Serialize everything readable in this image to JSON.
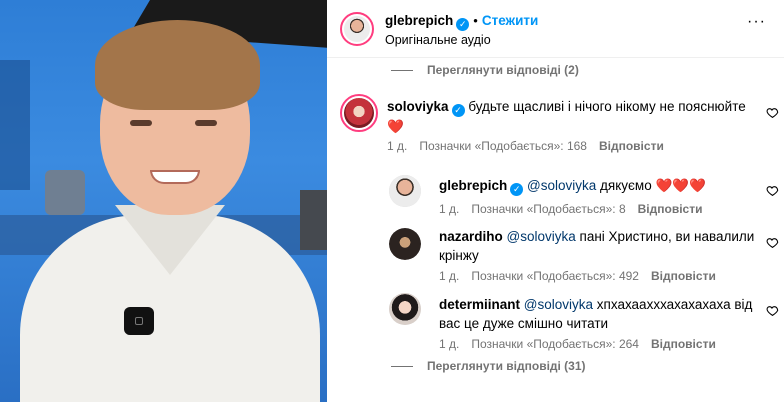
{
  "header": {
    "username": "glebrepich",
    "follow_label": "Стежити",
    "dot": "•",
    "audio": "Оригінальне аудіо",
    "more": "···"
  },
  "view_replies_top": "Переглянути відповіді (2)",
  "comment": {
    "username": "soloviyka",
    "text": "будьте щасливі і нічого нікому не пояснюйте",
    "emoji": "❤️",
    "time": "1 д.",
    "likes": "Позначки «Подобається»: 168",
    "reply_label": "Відповісти"
  },
  "replies": [
    {
      "username": "glebrepich",
      "verified": true,
      "mention": "@soloviyka",
      "text": "дякуємо",
      "emoji": "❤️❤️❤️",
      "time": "1 д.",
      "likes": "Позначки «Подобається»: 8",
      "reply_label": "Відповісти"
    },
    {
      "username": "nazardiho",
      "verified": false,
      "mention": "@soloviyka",
      "text_line1": "пані Христино, ви навалили",
      "text_line2": "крінжу",
      "time": "1 д.",
      "likes": "Позначки «Подобається»: 492",
      "reply_label": "Відповісти"
    },
    {
      "username": "determiinant",
      "verified": false,
      "mention": "@soloviyka",
      "text_line1": "хпхахаахххахахахаха від",
      "text_line2": "вас це дуже смішно читати",
      "time": "1 д.",
      "likes": "Позначки «Подобається»: 264",
      "reply_label": "Відповісти"
    }
  ],
  "view_replies_bottom": "Переглянути відповіді (31)",
  "icons": {
    "verified": "verified-badge-icon",
    "heart": "heart-outline-icon",
    "more": "more-options-icon"
  },
  "colors": {
    "accent": "#0095f6",
    "mention": "#00376b",
    "muted": "#737373",
    "heart_red": "#e0245e"
  }
}
